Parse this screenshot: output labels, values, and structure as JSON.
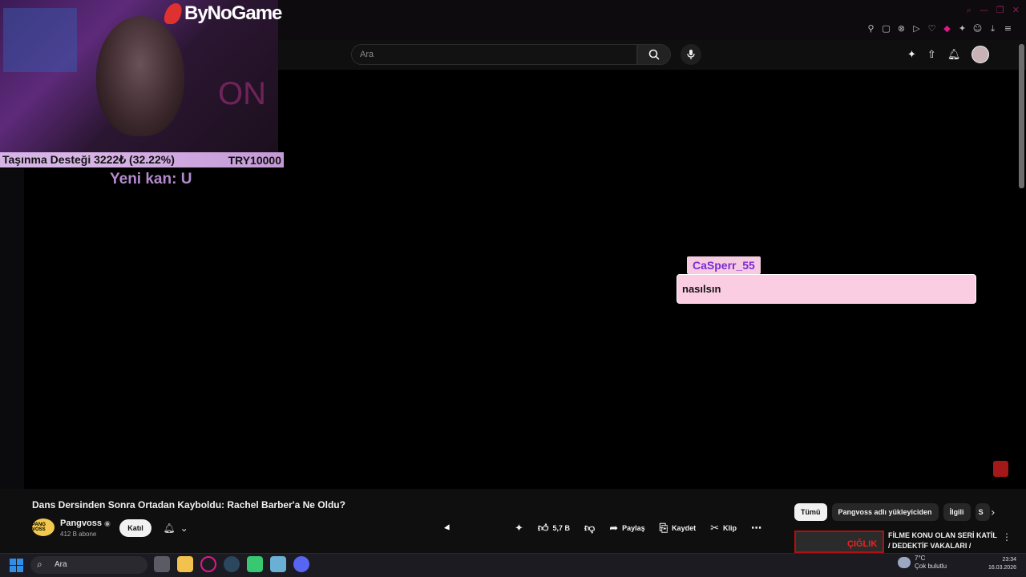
{
  "overlay": {
    "brand": "ByNoGame",
    "donation_left": "Taşınma Desteği 3222₺ (32.22%)",
    "donation_right": "TRY10000",
    "marquee": "Yeni kan: U"
  },
  "header": {
    "search_placeholder": "Ara"
  },
  "chat": {
    "username": "CaSperr_55",
    "message": "nasılsın"
  },
  "video": {
    "title": "Dans Dersinden Sonra Ortadan Kayboldu: Rachel Barber'a Ne Oldu?",
    "channel": "Pangvoss",
    "channel_badge": "PANG VOSS",
    "subscribers": "412 B abone",
    "join_label": "Katıl",
    "likes": "5,7 B",
    "share_label": "Paylaş",
    "save_label": "Kaydet",
    "clip_label": "Klip"
  },
  "chips": [
    "Tümü",
    "Pangvoss adlı yükleyiciden",
    "İlgili",
    "S"
  ],
  "recommendation": {
    "thumb_text": "ÇIĞLIK",
    "title": "FİLME KONU OLAN SERİ KATİL / DEDEKTİF VAKALARI /"
  },
  "taskbar": {
    "search_label": "Ara",
    "weather_temp": "7°C",
    "weather_desc": "Çok bulutlu",
    "time": "23:34",
    "date": "16.03.2026"
  }
}
